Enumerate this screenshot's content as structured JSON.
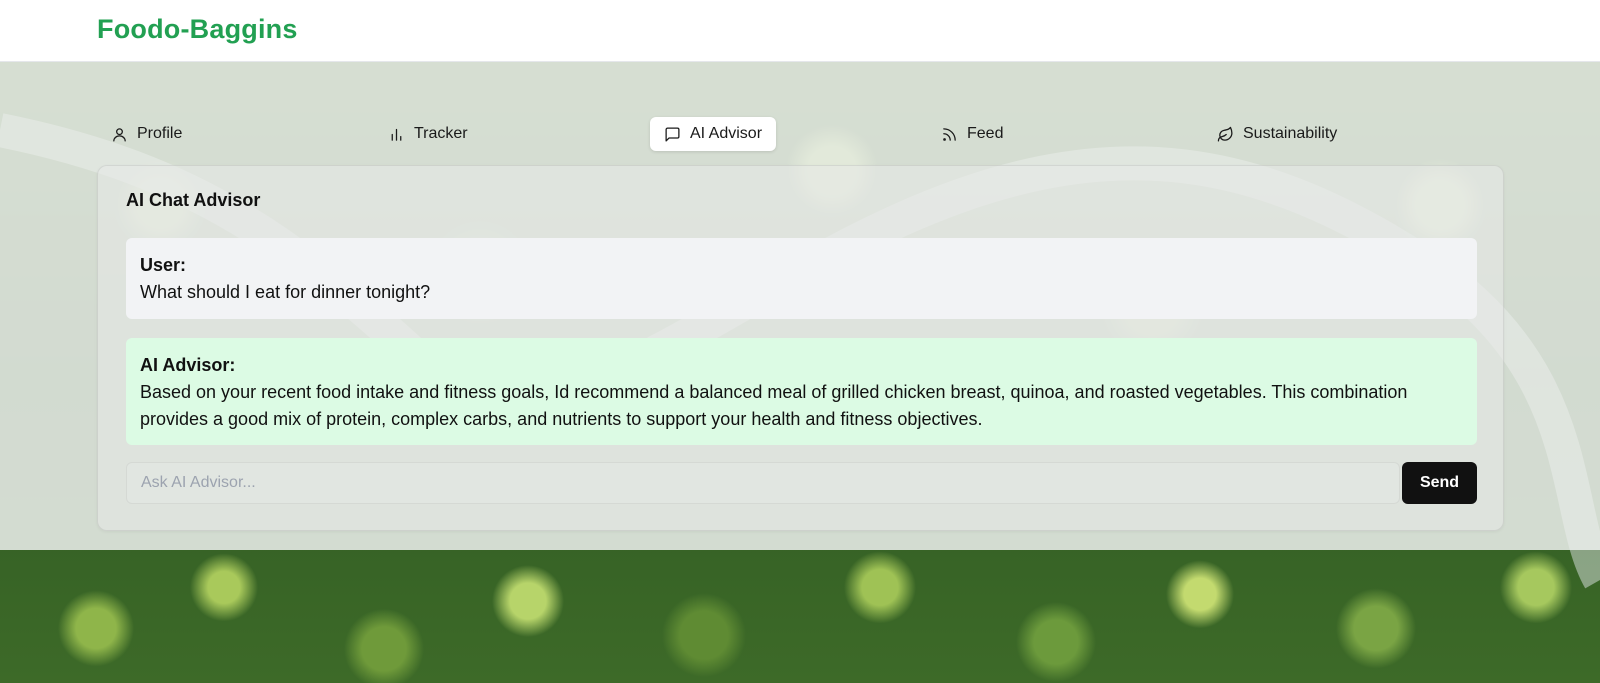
{
  "app": {
    "brand": "Foodo-Baggins",
    "brand_color": "#22a052"
  },
  "tabs": [
    {
      "label": "Profile",
      "icon": "user-icon",
      "active": false
    },
    {
      "label": "Tracker",
      "icon": "bar-chart-icon",
      "active": false
    },
    {
      "label": "AI Advisor",
      "icon": "message-square-icon",
      "active": true
    },
    {
      "label": "Feed",
      "icon": "rss-icon",
      "active": false
    },
    {
      "label": "Sustainability",
      "icon": "leaf-icon",
      "active": false
    }
  ],
  "chat": {
    "title": "AI Chat Advisor",
    "messages": [
      {
        "sender": "User:",
        "text": "What should I eat for dinner tonight?",
        "background": "#f2f3f5"
      },
      {
        "sender": "AI Advisor:",
        "text": "Based on your recent food intake and fitness goals, Id recommend a balanced meal of grilled chicken breast, quinoa, and roasted vegetables. This combination provides a good mix of protein, complex carbs, and nutrients to support your health and fitness objectives.",
        "background": "#dcfbe4"
      }
    ],
    "input": {
      "value": "",
      "placeholder": "Ask AI Advisor..."
    },
    "send_label": "Send"
  }
}
